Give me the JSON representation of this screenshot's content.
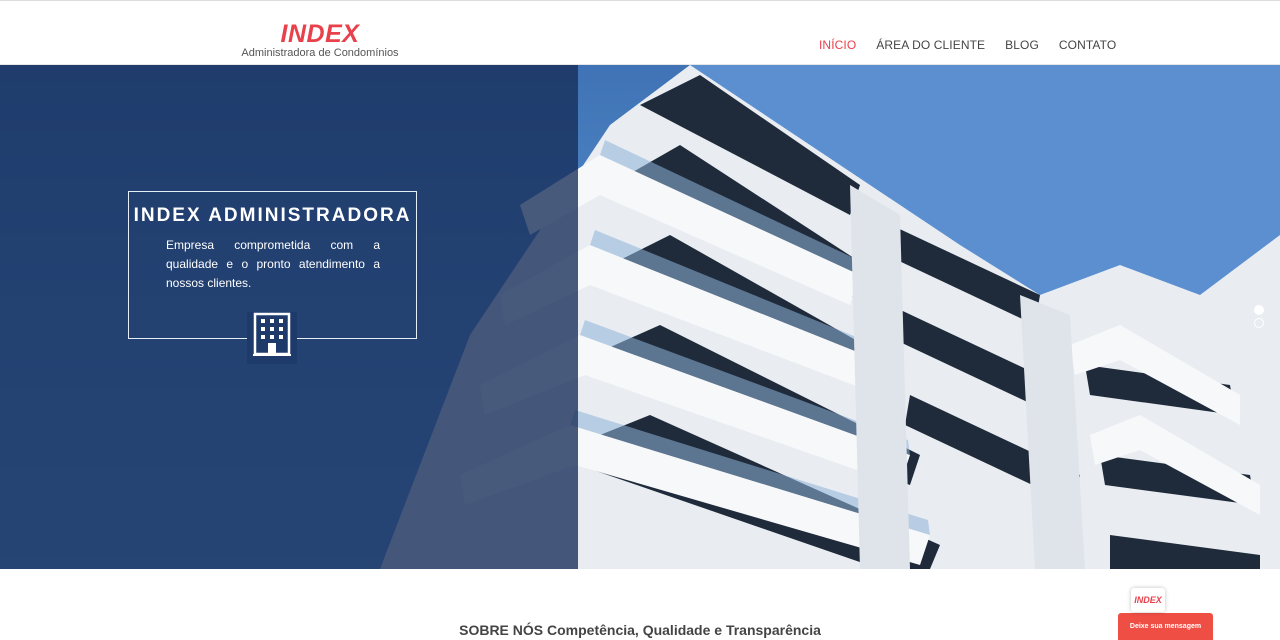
{
  "brand": {
    "name": "INDEX",
    "tagline": "Administradora de Condomínios",
    "color": "#e9414b"
  },
  "nav": {
    "items": [
      {
        "label": "INÍCIO",
        "active": true
      },
      {
        "label": "ÁREA DO CLIENTE",
        "active": false
      },
      {
        "label": "BLOG",
        "active": false
      },
      {
        "label": "CONTATO",
        "active": false
      }
    ]
  },
  "hero": {
    "title": "INDEX ADMINISTRADORA",
    "text": "Empresa comprometida com a qualidade e o pronto atendimento a nossos clientes.",
    "icon": "building-icon",
    "slides": {
      "count": 2,
      "active": 1
    }
  },
  "about": {
    "heading_bold": "SOBRE NÓS",
    "heading_rest": " Competência, Qualidade e Transparência"
  },
  "chat": {
    "logo": "INDEX",
    "button_label": "Deixe sua mensagem",
    "color": "#ef4e45"
  }
}
